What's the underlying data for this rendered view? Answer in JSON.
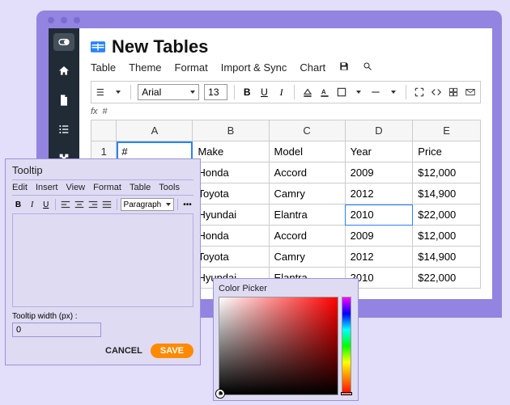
{
  "title": "New Tables",
  "menubar": [
    "Table",
    "Theme",
    "Format",
    "Import & Sync",
    "Chart"
  ],
  "font": {
    "name": "Arial",
    "size": "13"
  },
  "fx": {
    "label": "fx",
    "value": "#"
  },
  "columns": [
    "A",
    "B",
    "C",
    "D",
    "E"
  ],
  "rows": [
    {
      "n": "1",
      "cells": [
        "#",
        "Make",
        "Model",
        "Year",
        "Price"
      ]
    },
    {
      "n": "",
      "cells": [
        "",
        "Honda",
        "Accord",
        "2009",
        "$12,000"
      ]
    },
    {
      "n": "",
      "cells": [
        "",
        "Toyota",
        "Camry",
        "2012",
        "$14,900"
      ]
    },
    {
      "n": "",
      "cells": [
        "",
        "Hyundai",
        "Elantra",
        "2010",
        "$22,000"
      ]
    },
    {
      "n": "",
      "cells": [
        "",
        "Honda",
        "Accord",
        "2009",
        "$12,000"
      ]
    },
    {
      "n": "",
      "cells": [
        "",
        "Toyota",
        "Camry",
        "2012",
        "$14,900"
      ]
    },
    {
      "n": "",
      "cells": [
        "",
        "Hyundai",
        "Elantra",
        "2010",
        "$22,000"
      ]
    }
  ],
  "tooltip": {
    "title": "Tooltip",
    "menubar": [
      "Edit",
      "Insert",
      "View",
      "Format",
      "Table",
      "Tools"
    ],
    "paragraph_label": "Paragraph",
    "width_label": "Tooltip width (px) :",
    "width_value": "0",
    "cancel": "CANCEL",
    "save": "SAVE"
  },
  "colorpicker": {
    "title": "Color Picker"
  }
}
